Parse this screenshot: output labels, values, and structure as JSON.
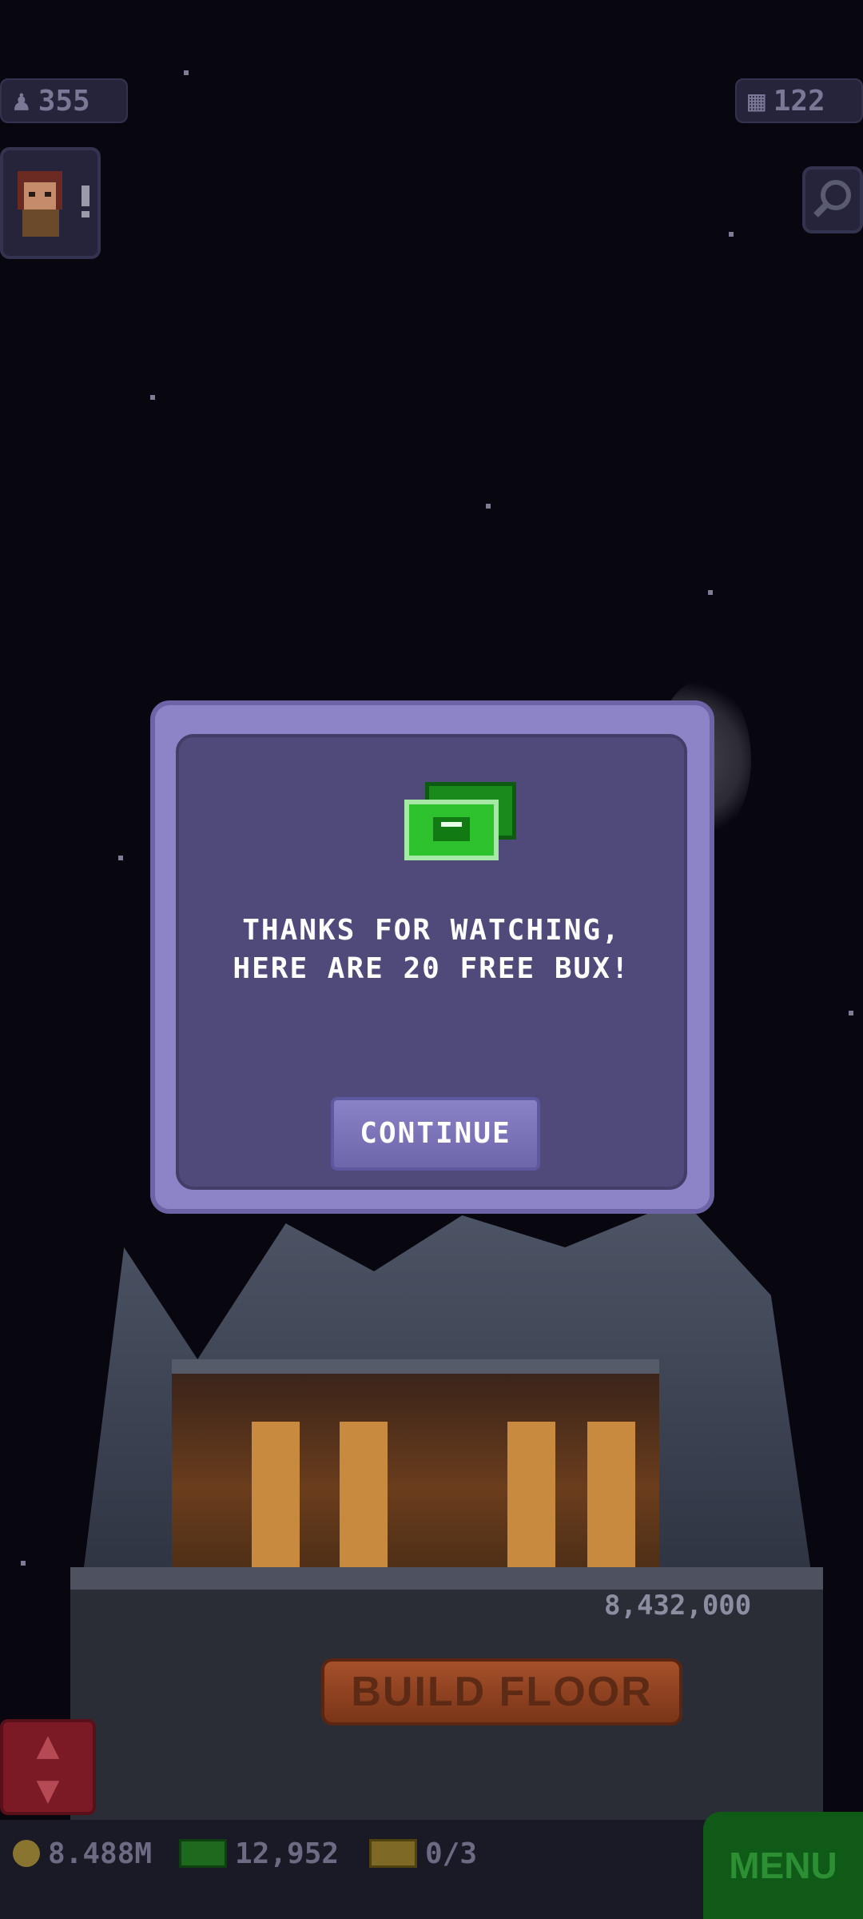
{
  "hud": {
    "population": "355",
    "population_icon": "person-icon",
    "floors": "122",
    "floors_icon": "building-icon"
  },
  "dialog": {
    "message": "THANKS FOR WATCHING,\nHERE ARE 20 FREE BUX!",
    "icon": "bux-icon",
    "continue_label": "CONTINUE"
  },
  "tower": {
    "floor_cost": "8,432,000",
    "build_floor_label": "BUILD FLOOR"
  },
  "bottom_bar": {
    "coins": "8.488M",
    "bux": "12,952",
    "tickets": "0/3",
    "menu_label": "MENU"
  },
  "colors": {
    "dialog_frame": "#8d84c8",
    "dialog_body": "#4f4a7a",
    "bux_green": "#2ec22e",
    "menu_green": "#0f5a16",
    "build_orange": "#a5502a"
  }
}
